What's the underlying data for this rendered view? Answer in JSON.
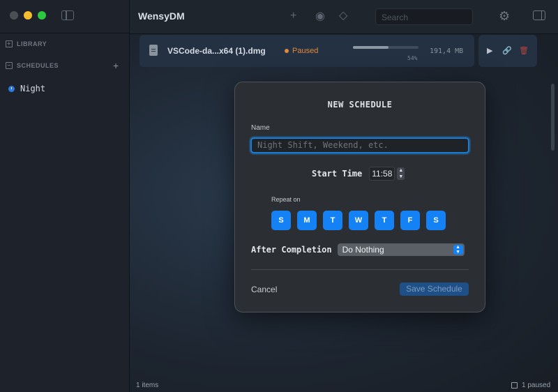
{
  "app": {
    "title": "WensyDM"
  },
  "sidebar": {
    "library_label": "LIBRARY",
    "schedules_label": "SCHEDULES",
    "schedules": [
      {
        "label": "Night"
      }
    ]
  },
  "toolbar": {
    "search_placeholder": "Search"
  },
  "download": {
    "file_name": "VSCode-da...x64 (1).dmg",
    "status": "Paused",
    "progress": 0.54,
    "progress_label": "54%",
    "size": "191,4 MB"
  },
  "statusbar": {
    "items": "1 items",
    "paused": "1 paused"
  },
  "modal": {
    "title": "NEW SCHEDULE",
    "name_label": "Name",
    "name_placeholder": "Night Shift, Weekend, etc.",
    "start_time_label": "Start Time",
    "start_time": "11:58",
    "repeat_label": "Repeat on",
    "days": [
      "S",
      "M",
      "T",
      "W",
      "T",
      "F",
      "S"
    ],
    "after_completion_label": "After Completion",
    "after_completion_value": "Do Nothing",
    "cancel_label": "Cancel",
    "save_label": "Save Schedule"
  },
  "colors": {
    "accent": "#1482f5",
    "paused": "#e08a3d",
    "window_bg": "#1b2027",
    "modal_bg": "#2b2e33"
  }
}
